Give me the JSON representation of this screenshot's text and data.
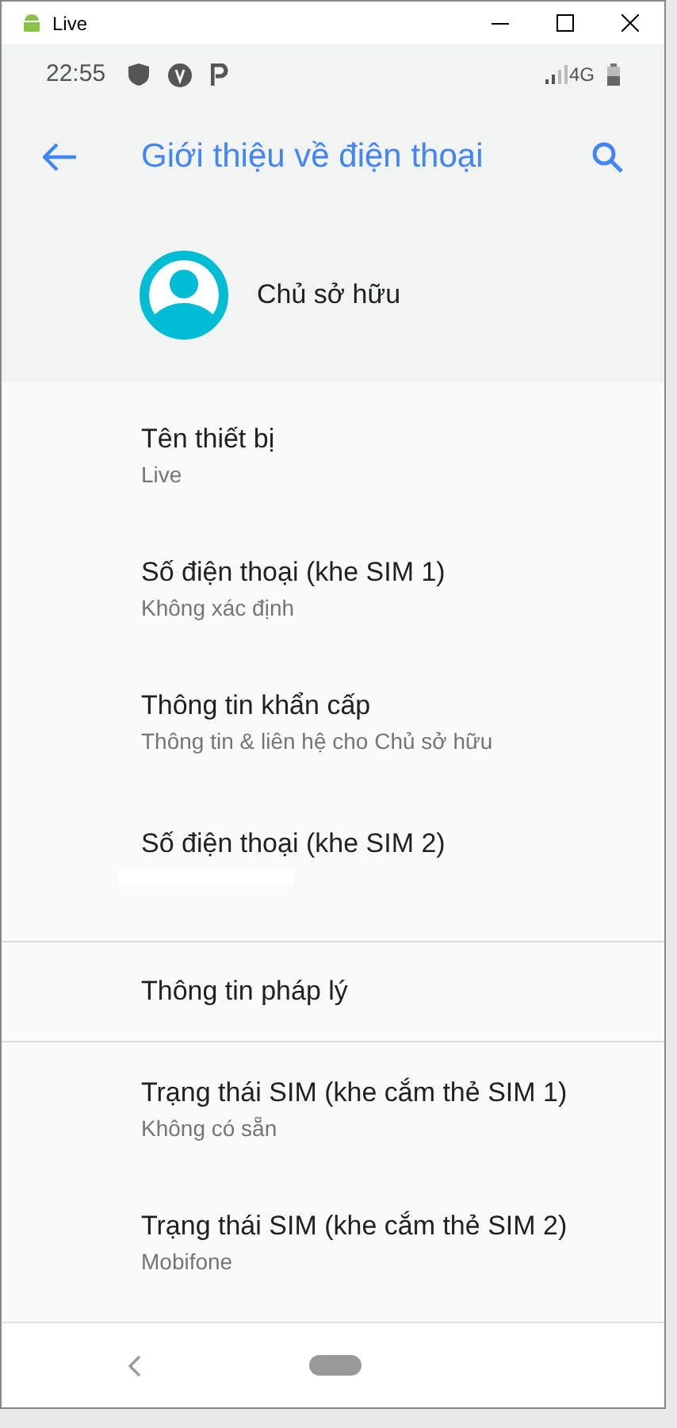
{
  "window": {
    "title": "Live"
  },
  "status_bar": {
    "time": "22:55",
    "network": "4G"
  },
  "toolbar": {
    "title": "Giới thiệu về điện thoại"
  },
  "owner": {
    "name": "Chủ sở hữu"
  },
  "items": [
    {
      "kind": "entry",
      "title": "Tên thiết bị",
      "subtitle": "Live"
    },
    {
      "kind": "entry",
      "title": "Số điện thoại (khe SIM 1)",
      "subtitle": "Không xác định"
    },
    {
      "kind": "entry",
      "title": "Thông tin khẩn cấp",
      "subtitle": "Thông tin & liên hệ cho Chủ sở hữu"
    },
    {
      "kind": "redacted",
      "title": "Số điện thoại (khe SIM 2)"
    },
    {
      "kind": "divider"
    },
    {
      "kind": "entry",
      "title": "Thông tin pháp lý"
    },
    {
      "kind": "divider"
    },
    {
      "kind": "entry",
      "title": "Trạng thái SIM (khe cắm thẻ SIM 1)",
      "subtitle": "Không có sẵn"
    },
    {
      "kind": "entry",
      "title": "Trạng thái SIM (khe cắm thẻ SIM 2)",
      "subtitle": "Mobifone"
    }
  ]
}
